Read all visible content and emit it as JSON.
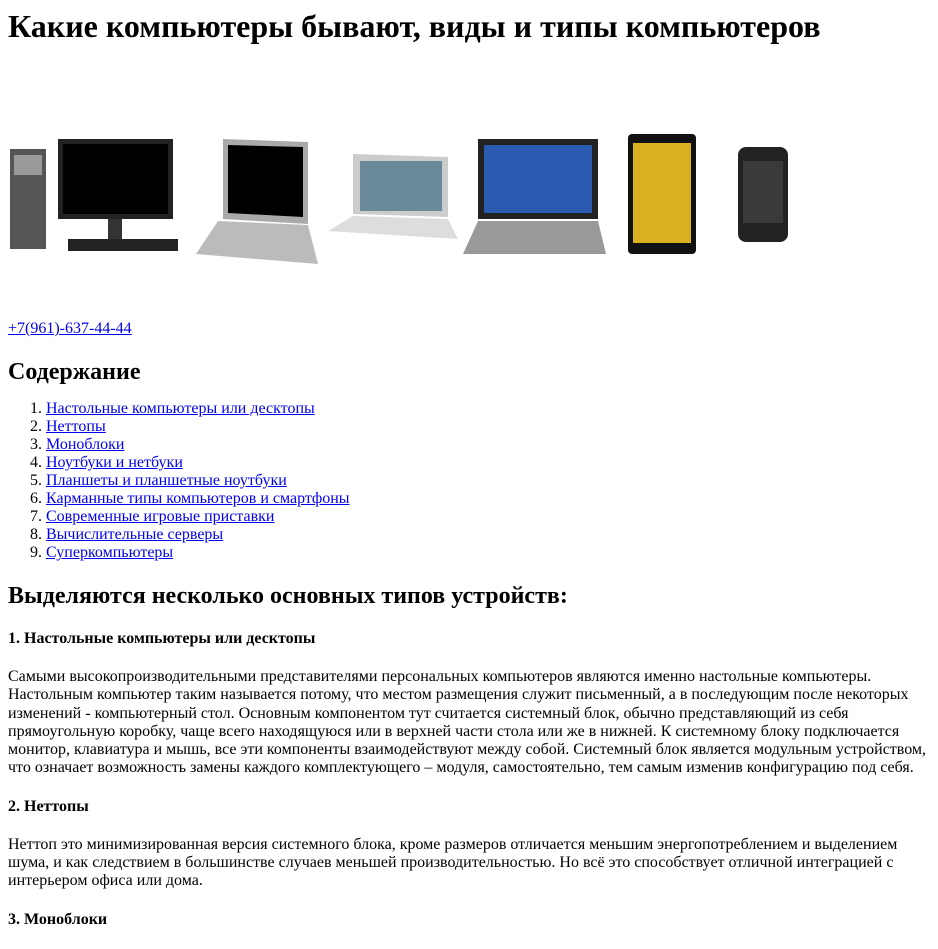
{
  "title": "Какие компьютеры бывают, виды и типы компьютеров",
  "hero_image": {
    "icon": "devices-image"
  },
  "phone": "+7(961)-637-44-44",
  "toc": {
    "heading": "Содержание",
    "items": [
      "Настольные компьютеры или десктопы",
      "Неттопы",
      "Моноблоки",
      "Ноутбуки и нетбуки",
      "Планшеты и планшетные ноутбуки",
      "Карманные типы компьютеров и смартфоны",
      "Современные игровые приставки",
      "Вычислительные серверы",
      "Суперкомпьютеры"
    ]
  },
  "section_heading": "Выделяются несколько основных типов устройств:",
  "sections": [
    {
      "heading": "1. Настольные компьютеры или десктопы",
      "text": "Самыми высокопроизводительными представителями персональных компьютеров являются именно настольные компьютеры. Настольным компьютер таким называется потому, что местом размещения служит письменный, а в последующим после некоторых изменений - компьютерный стол. Основным компонентом тут считается системный блок, обычно представляющий из себя прямоугольную коробку, чаще всего находящуюся или в верхней части стола или же в нижней. К системному блоку подключается монитор, клавиатура и мышь, все эти компоненты взаимодействуют между собой. Системный блок является модульным устройством, что означает возможность замены каждого комплектующего – модуля, самостоятельно, тем самым изменив конфигурацию под себя."
    },
    {
      "heading": "2. Неттопы",
      "text": "Неттоп это минимизированная версия системного блока, кроме размеров отличается меньшим энергопотреблением и выделением шума, и как следствием в большинстве случаев меньшей производительностью. Но всё это способствует отличной интеграцией с интерьером офиса или дома."
    },
    {
      "heading": "3. Моноблоки"
    }
  ]
}
